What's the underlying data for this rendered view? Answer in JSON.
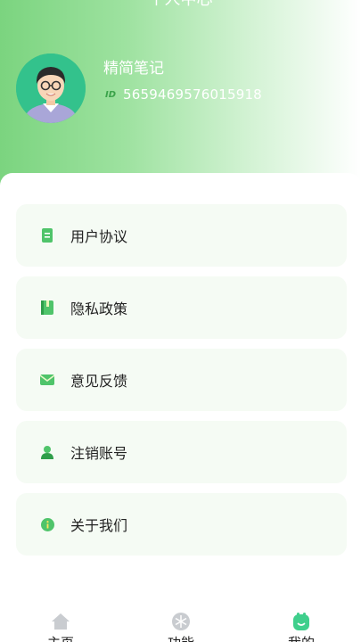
{
  "header": {
    "title": "个人中心",
    "username": "精简笔记",
    "id_label": "ID",
    "id_value": "5659469576015918"
  },
  "menu": [
    {
      "label": "用户协议",
      "icon": "document-icon"
    },
    {
      "label": "隐私政策",
      "icon": "book-icon"
    },
    {
      "label": "意见反馈",
      "icon": "mail-icon"
    },
    {
      "label": "注销账号",
      "icon": "user-icon"
    },
    {
      "label": "关于我们",
      "icon": "info-icon"
    }
  ],
  "tabbar": [
    {
      "label": "主页",
      "icon": "home-icon"
    },
    {
      "label": "功能",
      "icon": "snowflake-icon"
    },
    {
      "label": "我的",
      "icon": "profile-icon",
      "active": true
    }
  ],
  "colors": {
    "accent": "#5fc96b",
    "card_bg": "#f5fbf4"
  }
}
